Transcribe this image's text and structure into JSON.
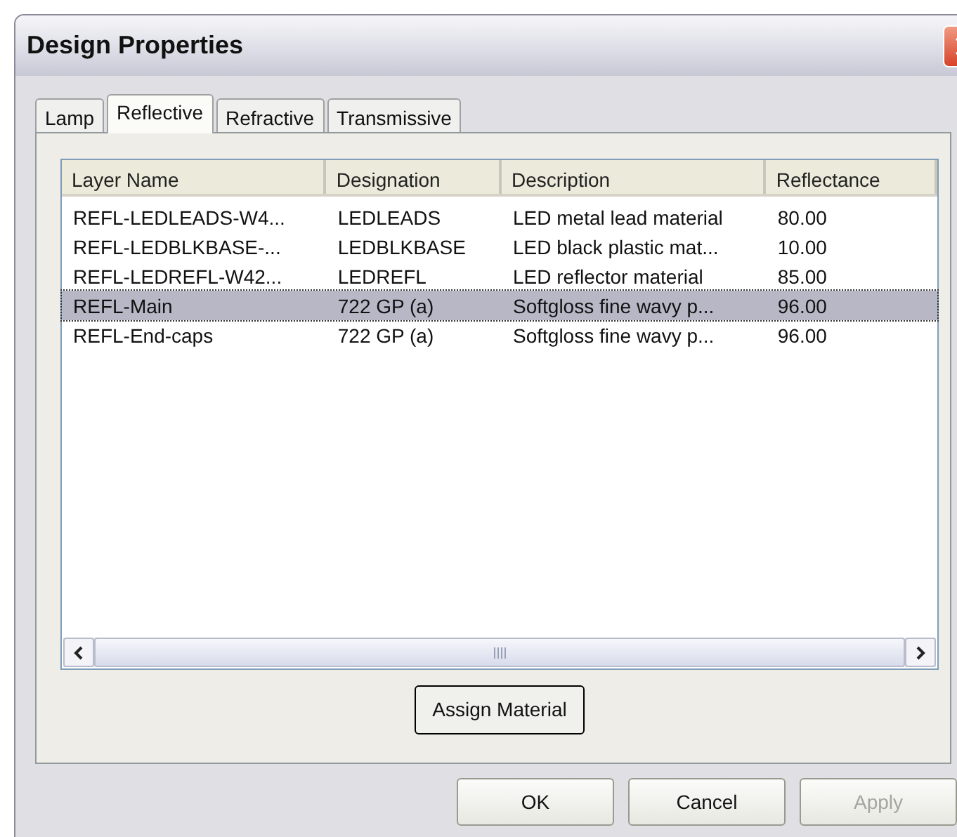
{
  "window": {
    "title": "Design Properties"
  },
  "tabs": [
    {
      "label": "Lamp",
      "selected": false
    },
    {
      "label": "Reflective",
      "selected": true
    },
    {
      "label": "Refractive",
      "selected": false
    },
    {
      "label": "Transmissive",
      "selected": false
    }
  ],
  "table": {
    "columns": [
      "Layer Name",
      "Designation",
      "Description",
      "Reflectance"
    ],
    "rows": [
      {
        "cells": [
          "REFL-LEDLEADS-W4...",
          "LEDLEADS",
          "LED metal lead material",
          "80.00"
        ],
        "selected": false
      },
      {
        "cells": [
          "REFL-LEDBLKBASE-...",
          "LEDBLKBASE",
          "LED black plastic mat...",
          "10.00"
        ],
        "selected": false
      },
      {
        "cells": [
          "REFL-LEDREFL-W42...",
          "LEDREFL",
          "LED reflector material",
          "85.00"
        ],
        "selected": false
      },
      {
        "cells": [
          "REFL-Main",
          "722 GP (a)",
          "Softgloss fine wavy p...",
          "96.00"
        ],
        "selected": true
      },
      {
        "cells": [
          "REFL-End-caps",
          "722 GP (a)",
          "Softgloss fine wavy p...",
          "96.00"
        ],
        "selected": false
      }
    ]
  },
  "assign_button": "Assign Material",
  "buttons": [
    {
      "label": "OK",
      "disabled": false
    },
    {
      "label": "Cancel",
      "disabled": false
    },
    {
      "label": "Apply",
      "disabled": true
    }
  ]
}
